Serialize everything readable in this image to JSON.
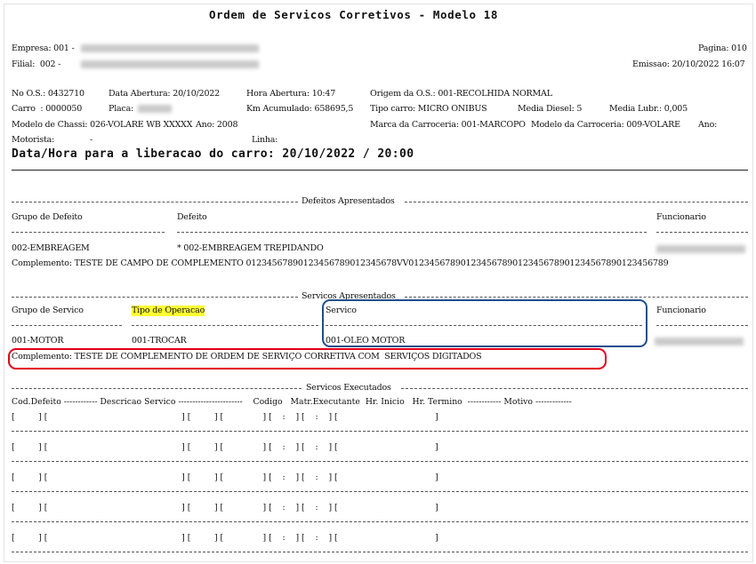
{
  "title": "Ordem de Servicos Corretivos - Modelo 18",
  "header": {
    "empresa_label": "Empresa: 001 -",
    "filial_label": "Filial:  002 -",
    "pagina": "Pagina: 010",
    "emissao": "Emissao: 20/10/2022 16:07"
  },
  "os": {
    "no_os": "No O.S.: 0432710",
    "data_abertura": "Data Abertura: 20/10/2022",
    "hora_abertura": "Hora Abertura: 10:47",
    "origem": "Origem da O.S.: 001-RECOLHIDA NORMAL",
    "carro": "Carro  : 0000050",
    "placa": "Placa:",
    "km": "Km Acumulado: 658695,5",
    "tipo_carro": "Tipo carro: MICRO ONIBUS",
    "media_diesel": "Media Diesel: 5",
    "media_lubr": "Media Lubr.: 0,005",
    "modelo_chassi": "Modelo de Chassi: 026-VOLARE WB XXXXX",
    "ano1": "Ano: 2008",
    "marca_carroceria": "Marca da Carroceria: 001-MARCOPO",
    "modelo_carroceria": "Modelo da Carroceria: 009-VOLARE",
    "ano2": "Ano:",
    "motorista": "Motorista:",
    "motorista_val": "-",
    "linha": "Linha:",
    "liberacao": "Data/Hora para a liberacao do carro: 20/10/2022 / 20:00"
  },
  "defeitos": {
    "section_title": "Defeitos Apresentados",
    "col_grupo": "Grupo de Defeito",
    "col_defeito": "Defeito",
    "col_funcionario": "Funcionario",
    "grupo": "002-EMBREAGEM",
    "defeito": "* 002-EMBREAGEM TREPIDANDO",
    "complemento": "Complemento: TESTE DE CAMPO DE COMPLEMENTO 01234567890123456789012345678VV01234567890123456789012345678901234567890123456789"
  },
  "servicos_apresentados": {
    "section_title": "Servicos Apresentados",
    "col_grupo": "Grupo de Servico",
    "col_tipo": "Tipo de Operacao",
    "col_servico": "Servico",
    "col_funcionario": "Funcionario",
    "grupo": "001-MOTOR",
    "tipo": "001-TROCAR",
    "servico": "001-OLEO MOTOR",
    "complemento": "Complemento: TESTE DE COMPLEMENTO DE ORDEM DE SERVIÇO CORRETIVA COM  SERVIÇOS DIGITADOS"
  },
  "servicos_executados": {
    "section_title": "Servicos Executados",
    "header_line": "Cod.Defeito ------------ Descricao Servico -----------------------    Codigo   Matr.Executante  Hr. Inicio   Hr. Termino  ------------ Motivo -------------",
    "row_line": "[         ] [                                                   ] [         ] [               ] [    :    ] [    :    ] [                                     ]",
    "rows": 5
  },
  "colors": {
    "highlight": "#ffff33",
    "red_mark": "#e3001b",
    "blue_mark": "#1f4e8c"
  }
}
